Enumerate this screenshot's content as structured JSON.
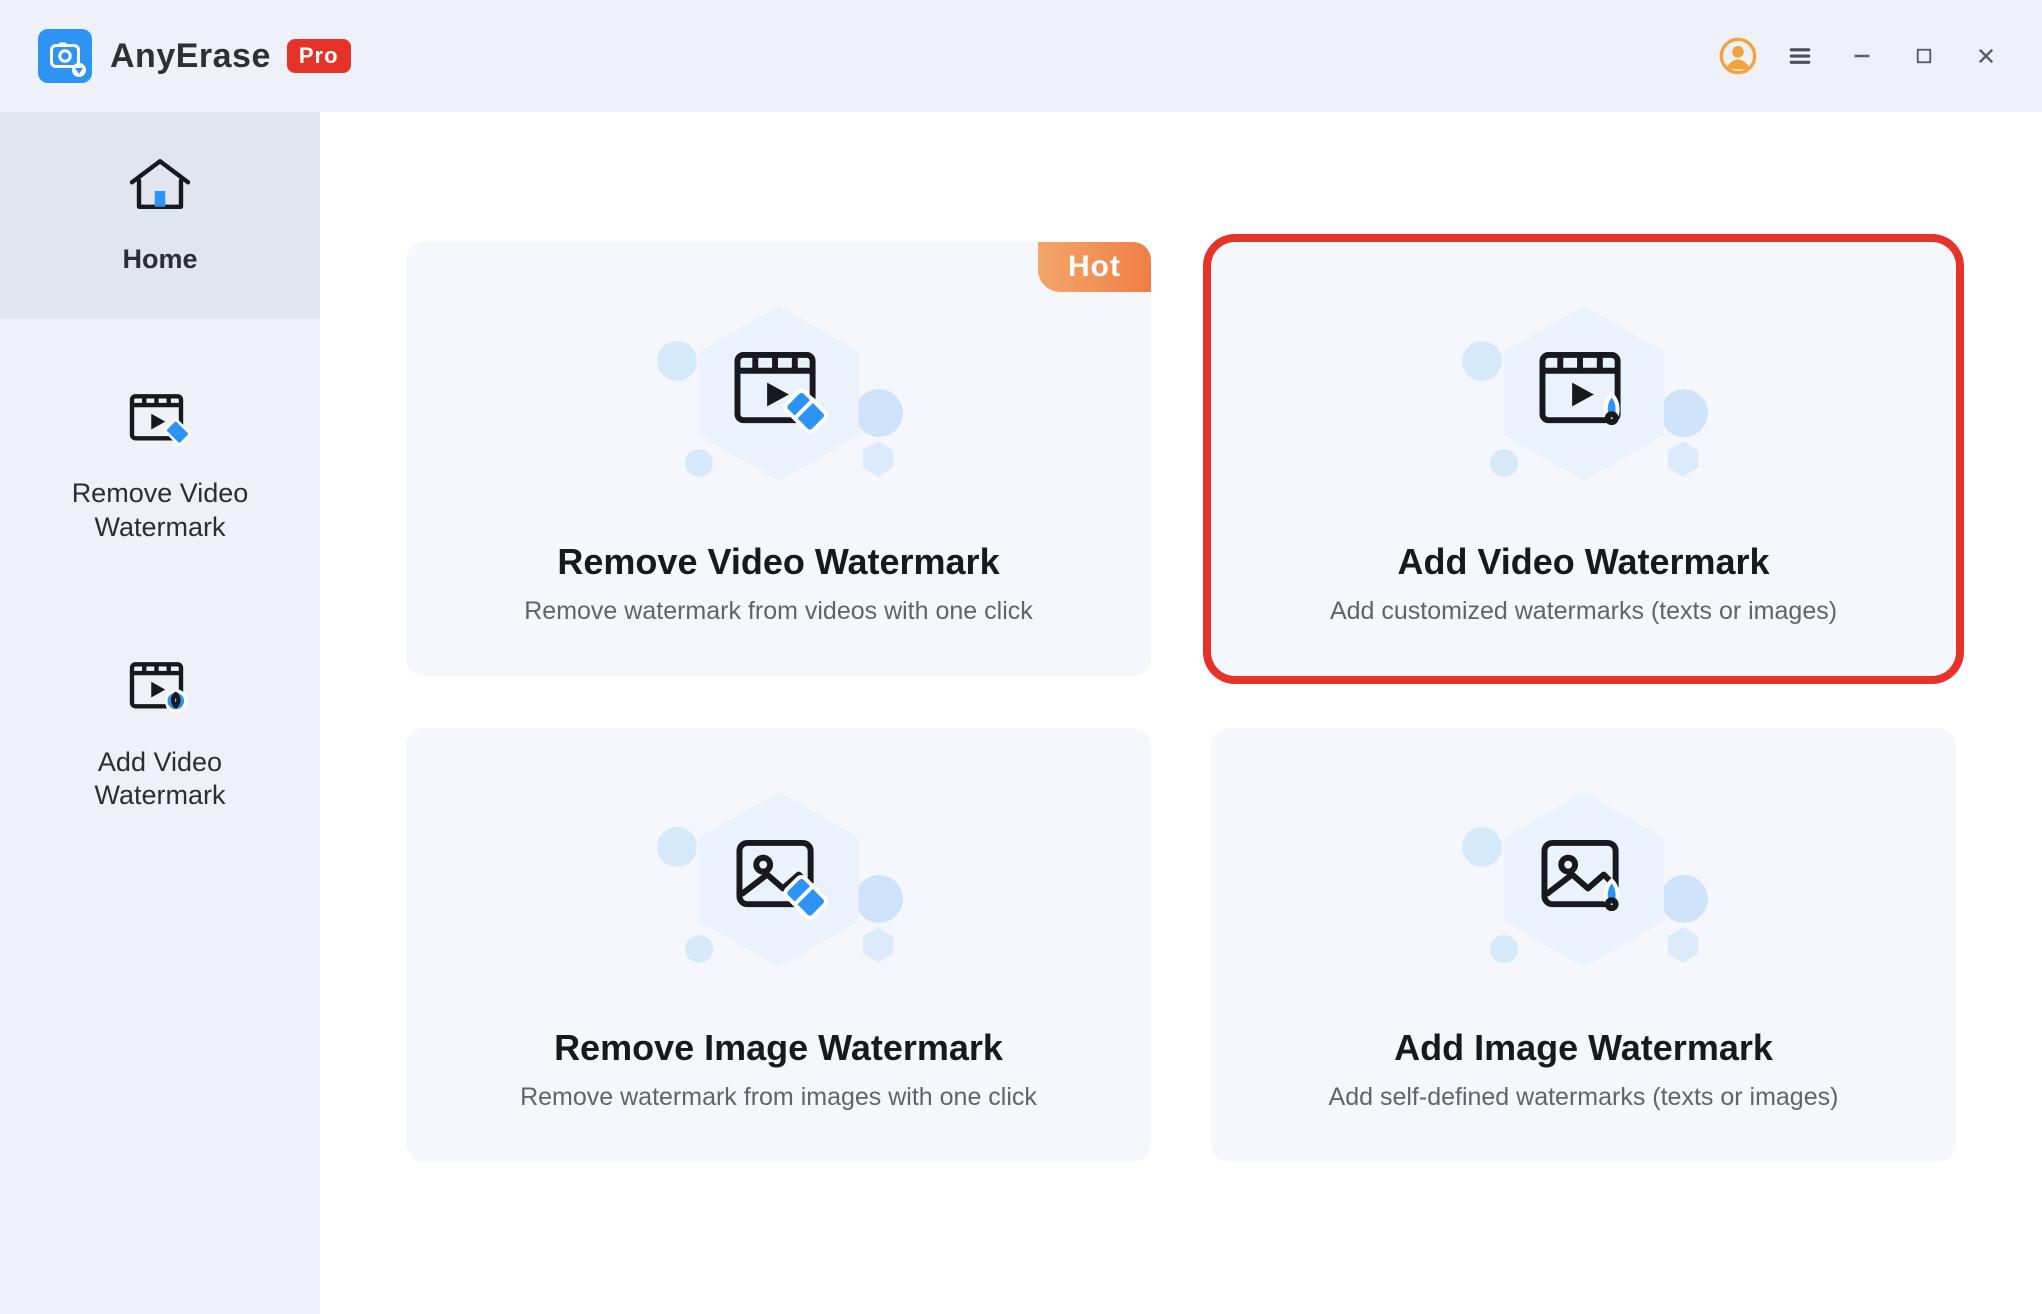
{
  "titlebar": {
    "app_name": "AnyErase",
    "pro_label": "Pro"
  },
  "sidebar": {
    "items": [
      {
        "label": "Home"
      },
      {
        "label": "Remove Video\nWatermark"
      },
      {
        "label": "Add Video\nWatermark"
      }
    ],
    "active_index": 0
  },
  "cards": [
    {
      "title": "Remove Video Watermark",
      "subtitle": "Remove watermark from videos with one click",
      "badge": "Hot",
      "highlighted": false,
      "icon": "video-erase"
    },
    {
      "title": "Add Video Watermark",
      "subtitle": "Add customized watermarks (texts or images)",
      "badge": null,
      "highlighted": true,
      "icon": "video-add"
    },
    {
      "title": "Remove Image Watermark",
      "subtitle": "Remove watermark from images with one click",
      "badge": null,
      "highlighted": false,
      "icon": "image-erase"
    },
    {
      "title": "Add Image Watermark",
      "subtitle": "Add self-defined watermarks  (texts or images)",
      "badge": null,
      "highlighted": false,
      "icon": "image-add"
    }
  ],
  "colors": {
    "accent_blue": "#2d94f3",
    "accent_red_highlight": "#e5332a",
    "hot_badge": "#f38b4a",
    "user_ring": "#f2a33c"
  }
}
